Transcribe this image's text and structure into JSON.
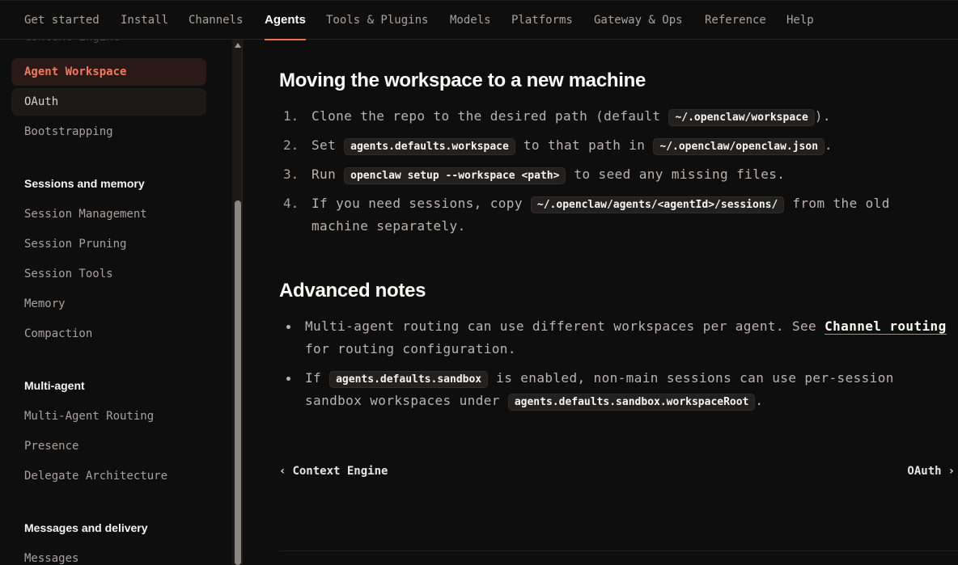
{
  "nav": {
    "tabs": [
      {
        "label": "Get started"
      },
      {
        "label": "Install"
      },
      {
        "label": "Channels"
      },
      {
        "label": "Agents",
        "active": true
      },
      {
        "label": "Tools & Plugins"
      },
      {
        "label": "Models"
      },
      {
        "label": "Platforms"
      },
      {
        "label": "Gateway & Ops"
      },
      {
        "label": "Reference"
      },
      {
        "label": "Help"
      }
    ]
  },
  "sidebar": {
    "partial_item": "Context Engine",
    "items": [
      "Agent Workspace",
      "OAuth",
      "Bootstrapping"
    ],
    "groups": [
      {
        "title": "Sessions and memory",
        "items": [
          "Session Management",
          "Session Pruning",
          "Session Tools",
          "Memory",
          "Compaction"
        ]
      },
      {
        "title": "Multi-agent",
        "items": [
          "Multi-Agent Routing",
          "Presence",
          "Delegate Architecture"
        ]
      },
      {
        "title": "Messages and delivery",
        "items": [
          "Messages"
        ]
      }
    ]
  },
  "content": {
    "section1": {
      "title": "Moving the workspace to a new machine",
      "steps": [
        {
          "n": "1.",
          "t1": "Clone the repo to the desired path (default ",
          "c1": "~/.openclaw/workspace",
          "t2": ")."
        },
        {
          "n": "2.",
          "t1": "Set ",
          "c1": "agents.defaults.workspace",
          "t2": " to that path in ",
          "c2": "~/.openclaw/openclaw.json",
          "t3": "."
        },
        {
          "n": "3.",
          "t1": "Run ",
          "c1": "openclaw setup --workspace <path>",
          "t2": " to seed any missing files."
        },
        {
          "n": "4.",
          "t1": "If you need sessions, copy ",
          "c1": "~/.openclaw/agents/<agentId>/sessions/",
          "t2": " from the old",
          "t3": "machine separately."
        }
      ]
    },
    "section2": {
      "title": "Advanced notes",
      "notes": [
        {
          "t1": "Multi-agent routing can use different workspaces per agent. See ",
          "link": "Channel routing",
          "t2": "for routing configuration."
        },
        {
          "t1": "If ",
          "c1": "agents.defaults.sandbox",
          "t2": " is enabled, non-main sessions can use per-session",
          "t3": "sandbox workspaces under ",
          "c2": "agents.defaults.sandbox.workspaceRoot",
          "t4": "."
        }
      ]
    },
    "pager": {
      "prev_icon": "chevron-left-icon",
      "prev": "Context Engine",
      "next": "OAuth",
      "next_icon": "chevron-right-icon"
    }
  },
  "colors": {
    "accent": "#ef6f55",
    "background": "#0f0e0e"
  }
}
